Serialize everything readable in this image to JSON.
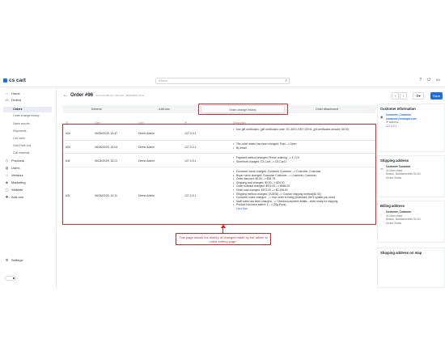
{
  "app": {
    "logo": "cs cart"
  },
  "search": {
    "placeholder": "Search"
  },
  "topbar": {
    "lang": "EN"
  },
  "sidebar": {
    "items": [
      {
        "label": "Home",
        "icon": "home-icon",
        "glyph": "⌂"
      },
      {
        "label": "Orders",
        "icon": "orders-icon",
        "glyph": "▭"
      },
      {
        "label": "Products",
        "icon": "products-icon",
        "glyph": "◇"
      },
      {
        "label": "Users",
        "icon": "users-icon",
        "glyph": "◍"
      },
      {
        "label": "Vendors",
        "icon": "vendors-icon",
        "glyph": "⌂"
      },
      {
        "label": "Marketing",
        "icon": "marketing-icon",
        "glyph": "◈"
      },
      {
        "label": "Website",
        "icon": "website-icon",
        "glyph": "▢"
      },
      {
        "label": "Add-ons",
        "icon": "addons-icon",
        "glyph": "✚"
      }
    ],
    "subitems": [
      "Orders",
      "Order change history",
      "Sales reports",
      "Shipments",
      "Live carts",
      "Gold Rate List",
      "Call requests"
    ],
    "settings": "Settings"
  },
  "order": {
    "title": "Order #96",
    "meta": "Total: $1,258.00 / CS-Cart · 06/26/2025 10:11"
  },
  "tabs": [
    "General",
    "Add-ons",
    "Order change history",
    "Order Attachment"
  ],
  "table": {
    "headers": [
      "ID",
      "Date",
      "User",
      "IP",
      "Description"
    ],
    "rows": [
      {
        "id": "#34",
        "date": "06/26/2025, 15:47",
        "user": "Demo Admin",
        "ip": "127.0.0.1",
        "desc": [
          "Use gift certificates: (gift certificates code: GC-8371-S307-D0H4, gift certificates amount: 50.00)"
        ]
      },
      {
        "id": "#33",
        "date": "06/26/2025, 15:04",
        "user": "Demo Admin",
        "ip": "127.0.0.1",
        "desc": [
          "The order status has been changed. Paid --> Open",
          "By email"
        ]
      },
      {
        "id": "#32",
        "date": "06/26/2025, 15:21",
        "user": "Demo Admin",
        "ip": "127.0.0.1",
        "desc": [
          "Payment method changed. Phone ordering --> C.O.D",
          "Storefront changed. CS-Cart --> CS-Cart 2"
        ]
      },
      {
        "id": "#31",
        "date": "06/26/2025, 10:11",
        "user": "Demo Admin",
        "ip": "127.0.0.1",
        "desc": [
          "Customer name changed. Customer Customer --> Customer. Customer",
          "Buyer name changed. Customer Customer --> Customer. Customer",
          "Order discount: $0.00 --> $36.75",
          "Shipping cost changed. $0.00 --> $20.00",
          "Order subtotal changed. $972.00 --> $984.00",
          "Order total changed. $972.00 --> $1,258.00",
          "Shipping method changed. (S2508) --> Custom shipping method($0.00)",
          "Customer notes changed. --> Your order is being processed. We'll update you soon!",
          "Staff notes has been changed. --> Checked payment details - order ready for shipping",
          "Product has been added: 1 --> (30g Pack)"
        ],
        "link": "Less less"
      }
    ]
  },
  "callout": "This page shows the history of changes made by the admin in order editing page.",
  "right": {
    "customer": {
      "title": "Customer Information",
      "name": "Customer, Customer",
      "email": "customer@example.com",
      "ip_label": "IP address:",
      "ip": "127.0.0.1"
    },
    "shipping": {
      "title": "Shipping address",
      "name": "Customer Customer",
      "l1": "44 Main street",
      "l2": "Boston, Massachusetts 02134",
      "l3": "United States"
    },
    "billing": {
      "title": "Billing address",
      "name": "Customer, Customer",
      "l1": "44 Main street",
      "l2": "Boston, Massachusetts 02134",
      "l3": "United States"
    },
    "map": {
      "title": "Shipping address on map"
    },
    "save": "Save"
  }
}
